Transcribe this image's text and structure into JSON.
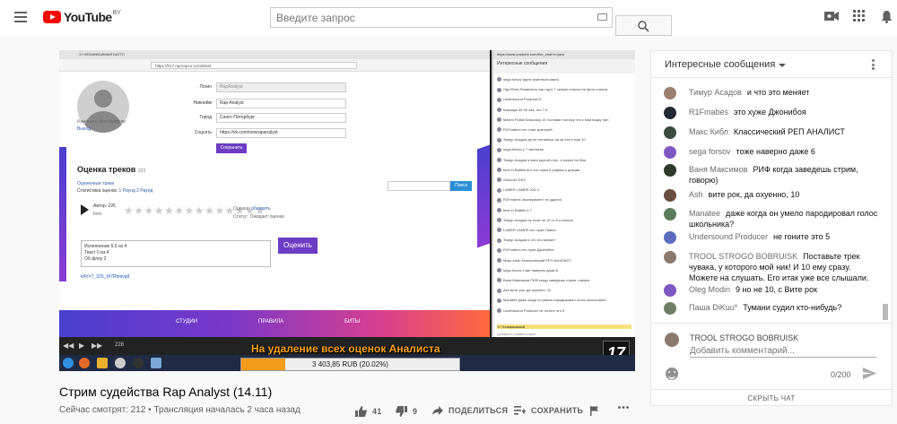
{
  "header": {
    "logo_text": "YouTube",
    "logo_region": "BY",
    "search_placeholder": "Введите запрос"
  },
  "video_frame": {
    "browser_tab": "17 НЕЗАВИСИМЫЙ БАТТЛ",
    "browser_url": "https://b17.rap-topcu.ru/cabinet",
    "change_photo": "Изменить фотографию",
    "logout": "Выход",
    "form": [
      {
        "label": "Логин",
        "value": "RapAnalyst",
        "disabled": true
      },
      {
        "label": "Никнейм",
        "value": "Rap Analyst",
        "disabled": false
      },
      {
        "label": "Город",
        "value": "Санкт-Петербург",
        "disabled": false
      },
      {
        "label": "Соцсеть",
        "value": "https://vk.com/newrapanalyst",
        "disabled": false
      }
    ],
    "save_button": "Сохранить",
    "section_title": "Оценка треков",
    "section_count": "323",
    "rated_link": "Оцененные треки",
    "stats_label": "Статистика оценок:",
    "stats_links": "1 Раунд 2 Раунд",
    "search_button": "Поиск",
    "author_label": "Автор: 226",
    "author_sub": "bvm",
    "rating_label": "Оценка:",
    "rating_link": "обновить",
    "status_label": "Статус: Ожидает оценки",
    "textarea_lines": [
      "Исполнение 5,5 из 4",
      "Текст 0 из 4",
      "Об флоу 2"
    ],
    "rate_button": "Оценить",
    "track_link": "kAY=7_326_W7Rfmlvq8",
    "nav_items": [
      "СТУДИИ",
      "ПРАВИЛА",
      "БИТЫ"
    ],
    "chat_popup_url": "https://www.youtube.com/live_chat?v=jarw",
    "chat_popup_title": "Интересные сообщения",
    "chat_popup_rows": [
      "sega forsov  идею заинтересовать",
      "Oga Ebes  Развалить как год в 7 сказал поясно на фото класса",
      "Undersound Producer  Б",
      "Казанцы 05.00  Ага, это 7,6",
      "Maxim Pollak  Классику 10 поставил потому что к нам водку пил",
      "R1Fmabes  это тоже критерий",
      "Тимур Асадов  да ни потянешь на за этого ему 10",
      "sega forsov  у 7 заплатил",
      "Тимур Асадов  я вата крутой стих, и пофиг на бом",
      "best in Battles  вот это норм и рифмы и дикция",
      "Shunold  2/3/3",
      "LAMER LAMER  226 4",
      "R1Fmabes  Эксперимент не удался",
      "best in Battles  а 7",
      "Тимур Асадов  ну если не 10 то 5 у класса",
      "LAMER LAMER  это хуже Павла",
      "Тимур Асадов  и что это меняет",
      "R1Fmabes  это хуже Джонибоя",
      "Макс Кибл  Классический РЕП АНАЛИСТ",
      "sega forsov  тоже наверно даже 6",
      "Ваня Максимов  РИФ когда заведешь стрим, говорю",
      "Ash  вите рок, да охуенно, 10",
      "Manatee  даже когда он умело пародировал голос школьника?",
      "Undersound Producer  не гоните это 5"
    ],
    "chat_popup_pinned": "17 Независимый",
    "chat_popup_input": "Добавить комментарий",
    "time_counter": "228",
    "overlay_text": "На удаление всех оценок Аналиста",
    "logo_number": "17",
    "donate_text": "3 403,85 RUB (20.02%)",
    "donate_progress": 0.2002
  },
  "video": {
    "title": "Стрим судейства Rap Analyst (14.11)",
    "meta": "Сейчас смотрят: 212 • Трансляция началась 2 часа назад",
    "likes": "41",
    "dislikes": "9",
    "share_label": "ПОДЕЛИТЬСЯ",
    "save_label": "СОХРАНИТЬ"
  },
  "chat": {
    "header_title": "Интересные сообщения",
    "messages": [
      {
        "author": "Тимур Асадов",
        "text": "и что это меняет",
        "avatar_color": "#9b7f70"
      },
      {
        "author": "R1Fmabes",
        "text": "это хуже Джонибоя",
        "avatar_color": "#222831"
      },
      {
        "author": "Макс Кибл",
        "text": "Классический РЕП АНАЛИСТ",
        "avatar_color": "#3a4d3f"
      },
      {
        "author": "sega forsov",
        "text": "тоже наверно даже 6",
        "avatar_color": "#7e57c2"
      },
      {
        "author": "Ваня Максимов",
        "text": "РИФ когда заведешь стрим, говорю)",
        "avatar_color": "#2f3a2c"
      },
      {
        "author": "Ash",
        "text": "вите рок, да охуенно, 10",
        "avatar_color": "#6a4f3f"
      },
      {
        "author": "Manatee",
        "text": "даже когда он умело пародировал голос школьника?",
        "avatar_color": "#5e7a5c"
      },
      {
        "author": "Undersound Producer",
        "text": "не гоните это 5",
        "avatar_color": "#5c6bc0"
      },
      {
        "author": "TROOL STROGO BOBRUISK",
        "text": "Поставьте трек чувака, у которого мой ник! И 10 ему сразу. Можете на слушать. Его итак уже все слышали.",
        "avatar_color": "#8d7a6e"
      },
      {
        "author": "Oleg Modin",
        "text": "9 но не 10, с Вите рок",
        "avatar_color": "#7e57c2"
      },
      {
        "author": "Паша DiKuu*",
        "text": "Тумани судил кто-нибудь?",
        "avatar_color": "#6f7f66"
      }
    ],
    "composer_name": "TROOL STROGO BOBRUISK",
    "composer_placeholder": "Добавить комментарий...",
    "counter": "0/200",
    "hide_chat": "СКРЫТЬ ЧАТ"
  }
}
